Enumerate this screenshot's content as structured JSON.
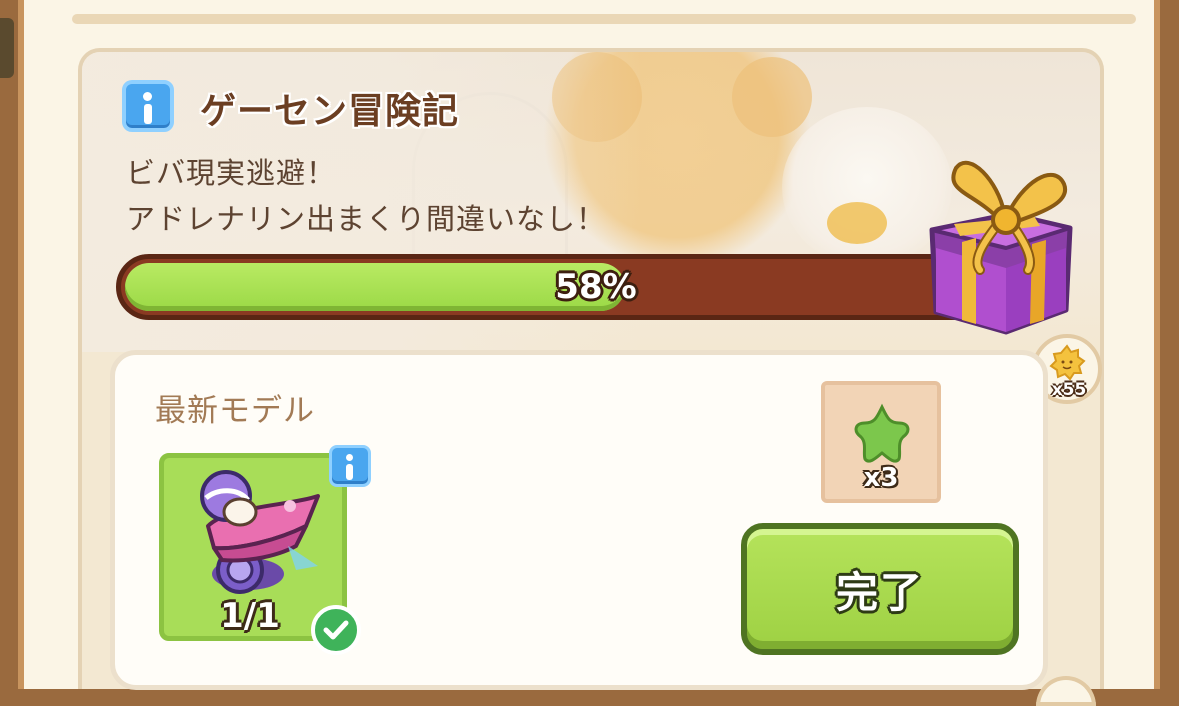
{
  "quest": {
    "title": "ゲーセン冒険記",
    "description_line1": "ビバ現実逃避！",
    "description_line2": "アドレナリン出まくり間違いなし！",
    "progress_percent": 58,
    "progress_label": "58%"
  },
  "bonus_reward": {
    "icon": "gift-box-icon",
    "coin_icon": "sun-coin-icon",
    "count_label": "x55"
  },
  "task": {
    "label": "最新モデル",
    "item_icon": "kart-character-icon",
    "item_count_label": "1/1",
    "completed": true,
    "reward_icon": "green-star-icon",
    "reward_count_label": "x3",
    "complete_button_label": "完了"
  },
  "colors": {
    "progress_fill": "#9bd946",
    "progress_track": "#8a3a22",
    "button_green": "#9ed143",
    "title_brown": "#6b3e22",
    "info_blue": "#4aa6ef"
  }
}
